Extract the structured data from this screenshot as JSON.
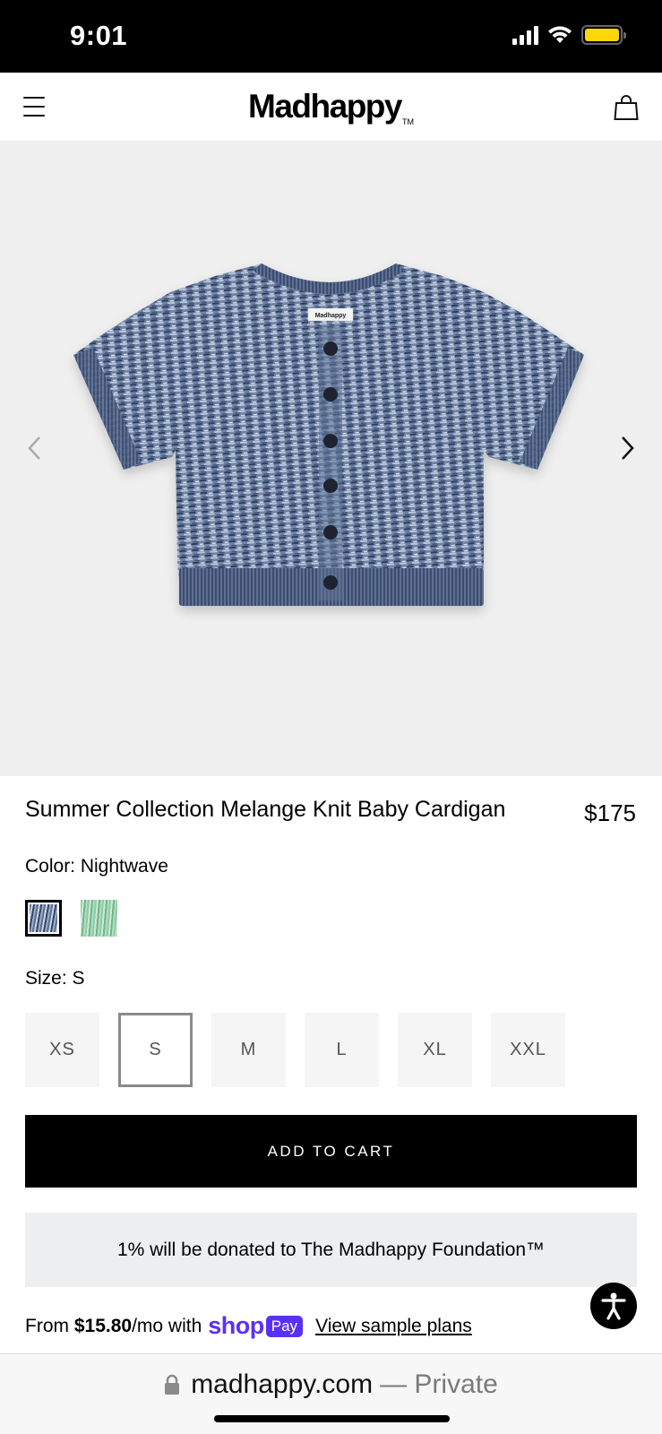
{
  "status_bar": {
    "time": "9:01"
  },
  "header": {
    "logo": "Madhappy",
    "logo_mark": "TM",
    "menu_icon": "hamburger-icon",
    "cart_icon": "shopping-bag-icon"
  },
  "product": {
    "image_label": "Madhappy",
    "title": "Summer Collection Melange Knit Baby Cardigan",
    "price": "$175",
    "color_label": "Color: Nightwave",
    "size_label": "Size: S",
    "sizes": [
      "XS",
      "S",
      "M",
      "L",
      "XL",
      "XXL"
    ],
    "selected_size": "S",
    "add_to_cart": "ADD TO CART",
    "donation": "1% will be donated to The Madhappy Foundation™"
  },
  "installments": {
    "from": "From",
    "amount": "$15.80",
    "per": "/mo with",
    "shop": "shop",
    "pay": "Pay",
    "link": "View sample plans"
  },
  "browser": {
    "domain": "madhappy.com",
    "private": "— Private"
  },
  "colors": {
    "accent": "#5a31f4",
    "button": "#000000",
    "donation_bg": "#eceef0",
    "gallery_bg": "#efefef"
  }
}
